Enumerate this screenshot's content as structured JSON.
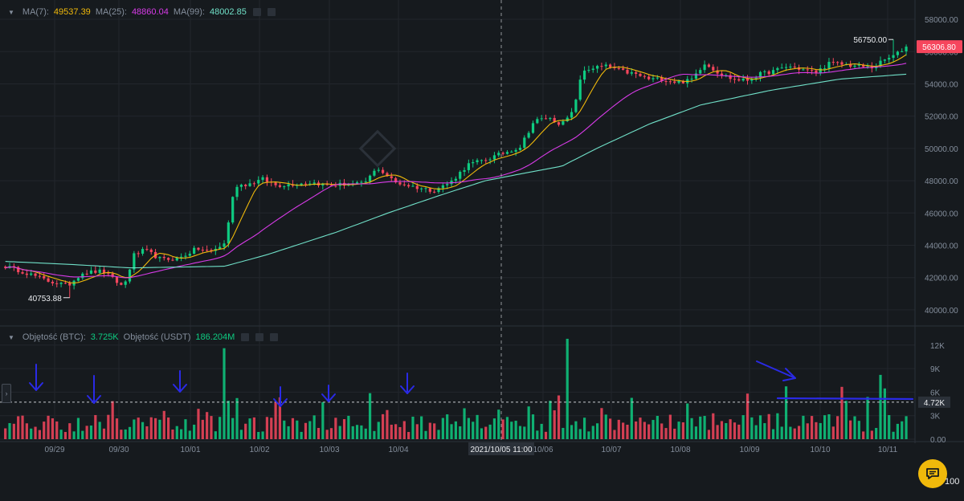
{
  "colors": {
    "background": "#161a1e",
    "up": "#0ecb81",
    "down": "#f6465d",
    "ma7": "#f0b90b",
    "ma25": "#d83be8",
    "ma99": "#70e0c8",
    "grid": "#22262c",
    "annotation": "#2a2ae6",
    "accent": "#f0b90b"
  },
  "legend": {
    "ma7_label": "MA(7):",
    "ma7_value": "49537.39",
    "ma25_label": "MA(25):",
    "ma25_value": "48860.04",
    "ma99_label": "MA(99):",
    "ma99_value": "48002.85",
    "vol_btc_label": "Objętość (BTC):",
    "vol_btc_value": "3.725K",
    "vol_usdt_label": "Objętość (USDT)",
    "vol_usdt_value": "186.204M"
  },
  "labels": {
    "min_price": "40753.88",
    "max_price": "56750.00",
    "last_price": "56306.80",
    "volume_marker": "4.72K",
    "crosshair_time": "2021/10/05 11:00",
    "corner": "100",
    "collapse_tab": "›"
  },
  "icons": {
    "chat": "chat-icon",
    "collapse": "chevron-right-icon"
  },
  "chart_data": [
    {
      "type": "candlestick",
      "panel": "price",
      "x_tick_labels": [
        "09/29",
        "09/30",
        "10/01",
        "10/02",
        "10/03",
        "10/04",
        "10/06",
        "10/07",
        "10/08",
        "10/09",
        "10/10",
        "10/11"
      ],
      "y_ticks": [
        40000,
        42000,
        44000,
        46000,
        48000,
        50000,
        52000,
        54000,
        56000,
        58000
      ],
      "y_tick_labels": [
        "40000.00",
        "42000.00",
        "44000.00",
        "46000.00",
        "48000.00",
        "50000.00",
        "52000.00",
        "54000.00",
        "56000.00",
        "58000.00"
      ],
      "ylim": [
        39200,
        58600
      ],
      "close_path": [
        [
          0,
          42700
        ],
        [
          6,
          42300
        ],
        [
          12,
          41800
        ],
        [
          18,
          41500
        ],
        [
          22,
          42300
        ],
        [
          28,
          42400
        ],
        [
          34,
          41400
        ],
        [
          37,
          43400
        ],
        [
          40,
          43700
        ],
        [
          45,
          43100
        ],
        [
          50,
          43200
        ],
        [
          55,
          43800
        ],
        [
          59,
          43600
        ],
        [
          63,
          44100
        ],
        [
          66,
          47700
        ],
        [
          70,
          47800
        ],
        [
          74,
          48100
        ],
        [
          78,
          47700
        ],
        [
          83,
          47800
        ],
        [
          88,
          47900
        ],
        [
          93,
          47700
        ],
        [
          98,
          47800
        ],
        [
          103,
          47800
        ],
        [
          107,
          48800
        ],
        [
          112,
          47900
        ],
        [
          118,
          47600
        ],
        [
          123,
          47400
        ],
        [
          128,
          47900
        ],
        [
          133,
          49000
        ],
        [
          138,
          49300
        ],
        [
          143,
          49700
        ],
        [
          148,
          50100
        ],
        [
          152,
          51700
        ],
        [
          156,
          51900
        ],
        [
          160,
          51500
        ],
        [
          163,
          52200
        ],
        [
          166,
          54800
        ],
        [
          169,
          55000
        ],
        [
          173,
          55100
        ],
        [
          177,
          54800
        ],
        [
          181,
          54600
        ],
        [
          185,
          54300
        ],
        [
          189,
          54300
        ],
        [
          193,
          54100
        ],
        [
          197,
          54200
        ],
        [
          201,
          55300
        ],
        [
          205,
          54700
        ],
        [
          209,
          54300
        ],
        [
          213,
          54200
        ],
        [
          217,
          54600
        ],
        [
          221,
          54800
        ],
        [
          225,
          55100
        ],
        [
          229,
          54900
        ],
        [
          233,
          54700
        ],
        [
          237,
          55300
        ],
        [
          241,
          55200
        ],
        [
          245,
          55100
        ],
        [
          249,
          55000
        ],
        [
          253,
          55500
        ],
        [
          256,
          55800
        ],
        [
          259,
          56306.8
        ]
      ],
      "ma99_path": [
        [
          0,
          43000
        ],
        [
          20,
          42800
        ],
        [
          36,
          42600
        ],
        [
          63,
          42700
        ],
        [
          75,
          43400
        ],
        [
          95,
          44800
        ],
        [
          110,
          46000
        ],
        [
          125,
          47100
        ],
        [
          138,
          48000
        ],
        [
          150,
          48500
        ],
        [
          160,
          48900
        ],
        [
          170,
          50000
        ],
        [
          185,
          51500
        ],
        [
          200,
          52700
        ],
        [
          220,
          53600
        ],
        [
          240,
          54300
        ],
        [
          259,
          54600
        ]
      ],
      "annotations": {
        "min": {
          "value": 40753.88,
          "label": "40753.88"
        },
        "max": {
          "value": 56750.0,
          "label": "56750.00"
        },
        "last": {
          "value": 56306.8,
          "label": "56306.80"
        }
      }
    },
    {
      "type": "bar",
      "panel": "volume",
      "y_ticks": [
        0,
        3000,
        6000,
        9000,
        12000
      ],
      "y_tick_labels": [
        "0.00",
        "3K",
        "6K",
        "9K",
        "12K"
      ],
      "ylim": [
        0,
        13000
      ],
      "reference_line": 4720,
      "reference_label": "4.72K",
      "spikes": [
        [
          63,
          11600
        ],
        [
          162,
          12800
        ],
        [
          203,
          3300
        ],
        [
          252,
          8200
        ]
      ]
    }
  ]
}
